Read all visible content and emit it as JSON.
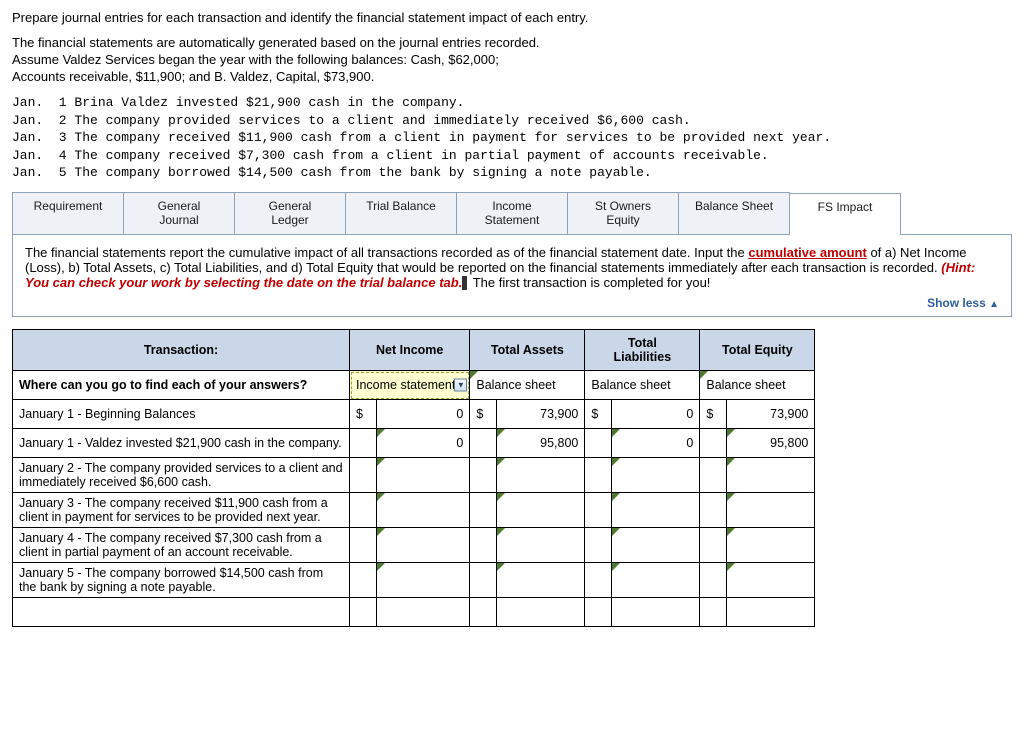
{
  "intro": {
    "line1": "Prepare journal entries for each transaction and identify the financial statement impact of each entry.",
    "line2": "The financial statements are automatically generated based on the journal entries recorded.",
    "line3": "Assume Valdez Services began the year with the following balances:  Cash, $62,000;",
    "line4": "Accounts receivable, $11,900; and B. Valdez, Capital, $73,900."
  },
  "mono": "Jan.  1 Brina Valdez invested $21,900 cash in the company.\nJan.  2 The company provided services to a client and immediately received $6,600 cash.\nJan.  3 The company received $11,900 cash from a client in payment for services to be provided next year.\nJan.  4 The company received $7,300 cash from a client in partial payment of accounts receivable.\nJan.  5 The company borrowed $14,500 cash from the bank by signing a note payable.",
  "tabs": [
    "Requirement",
    "General\nJournal",
    "General\nLedger",
    "Trial Balance",
    "Income\nStatement",
    "St Owners\nEquity",
    "Balance Sheet",
    "FS Impact"
  ],
  "active_tab": 7,
  "instruction": {
    "part1": "The financial statements report the cumulative impact of all transactions recorded as of the financial statement date.   Input the ",
    "cumulative": "cumulative amount",
    "part2": " of a) Net Income (Loss), b)  Total Assets, c) Total Liabilities, and d)  Total Equity that would be reported on the financial statements immediately after each transaction is recorded.  ",
    "hint": "(Hint:  You can check your work by selecting the date on the trial balance tab.",
    "part3": " The first transaction is completed for you!"
  },
  "show_less": "Show less",
  "headers": {
    "transaction": "Transaction:",
    "net_income": "Net Income",
    "total_assets": "Total Assets",
    "total_liab": "Total\nLiabilities",
    "total_equity": "Total Equity"
  },
  "hint_row": {
    "question": "Where can you go to find each of your answers?",
    "income": "Income statement",
    "assets": "Balance sheet",
    "liab": "Balance sheet",
    "equity": "Balance sheet"
  },
  "rows": [
    {
      "label": "January 1 -  Beginning Balances",
      "ni_cur": "$",
      "ni": "0",
      "ta_cur": "$",
      "ta": "73,900",
      "tl_cur": "$",
      "tl": "0",
      "te_cur": "$",
      "te": "73,900"
    },
    {
      "label": "January 1 -  Valdez invested $21,900 cash in the company.",
      "ni": "0",
      "ta": "95,800",
      "tl": "0",
      "te": "95,800"
    },
    {
      "label": "January 2 - The company provided services to a client and immediately received $6,600 cash."
    },
    {
      "label": "January 3 - The company received $11,900 cash from a client in payment for services to be provided next year."
    },
    {
      "label": "January 4 - The company received $7,300 cash from a client in partial payment of an account receivable."
    },
    {
      "label": "January 5 - The company borrowed $14,500 cash from the bank by signing a note payable."
    }
  ]
}
